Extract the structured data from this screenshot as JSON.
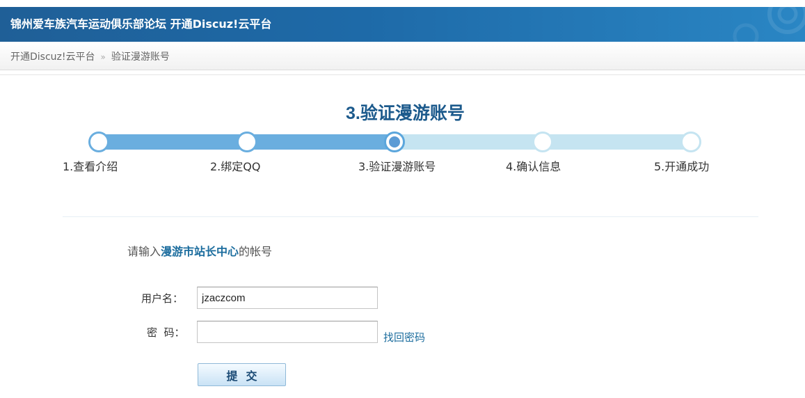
{
  "header": {
    "title": "锦州爱车族汽车运动俱乐部论坛 开通Discuz!云平台"
  },
  "breadcrumb": {
    "items": [
      "开通Discuz!云平台",
      "验证漫游账号"
    ],
    "separator": "»"
  },
  "steps": {
    "title": "3.验证漫游账号",
    "current_index": 3,
    "items": [
      {
        "label": "1.查看介绍"
      },
      {
        "label": "2.绑定QQ"
      },
      {
        "label": "3.验证漫游账号"
      },
      {
        "label": "4.确认信息"
      },
      {
        "label": "5.开通成功"
      }
    ]
  },
  "form": {
    "prompt_prefix": "请输入",
    "prompt_highlight": "漫游市站长中心",
    "prompt_suffix": "的帐号",
    "username_label": "用户名：",
    "username_value": "jzaczcom",
    "password_label": "密  码：",
    "password_value": "",
    "forgot_link": "找回密码",
    "submit_label": "提交"
  },
  "colors": {
    "header_bg": "#1e6aa8",
    "progress_done": "#6aaedf",
    "progress_todo": "#c5e4f1",
    "title_color": "#1c5a8c",
    "link_color": "#1c6d9e"
  }
}
